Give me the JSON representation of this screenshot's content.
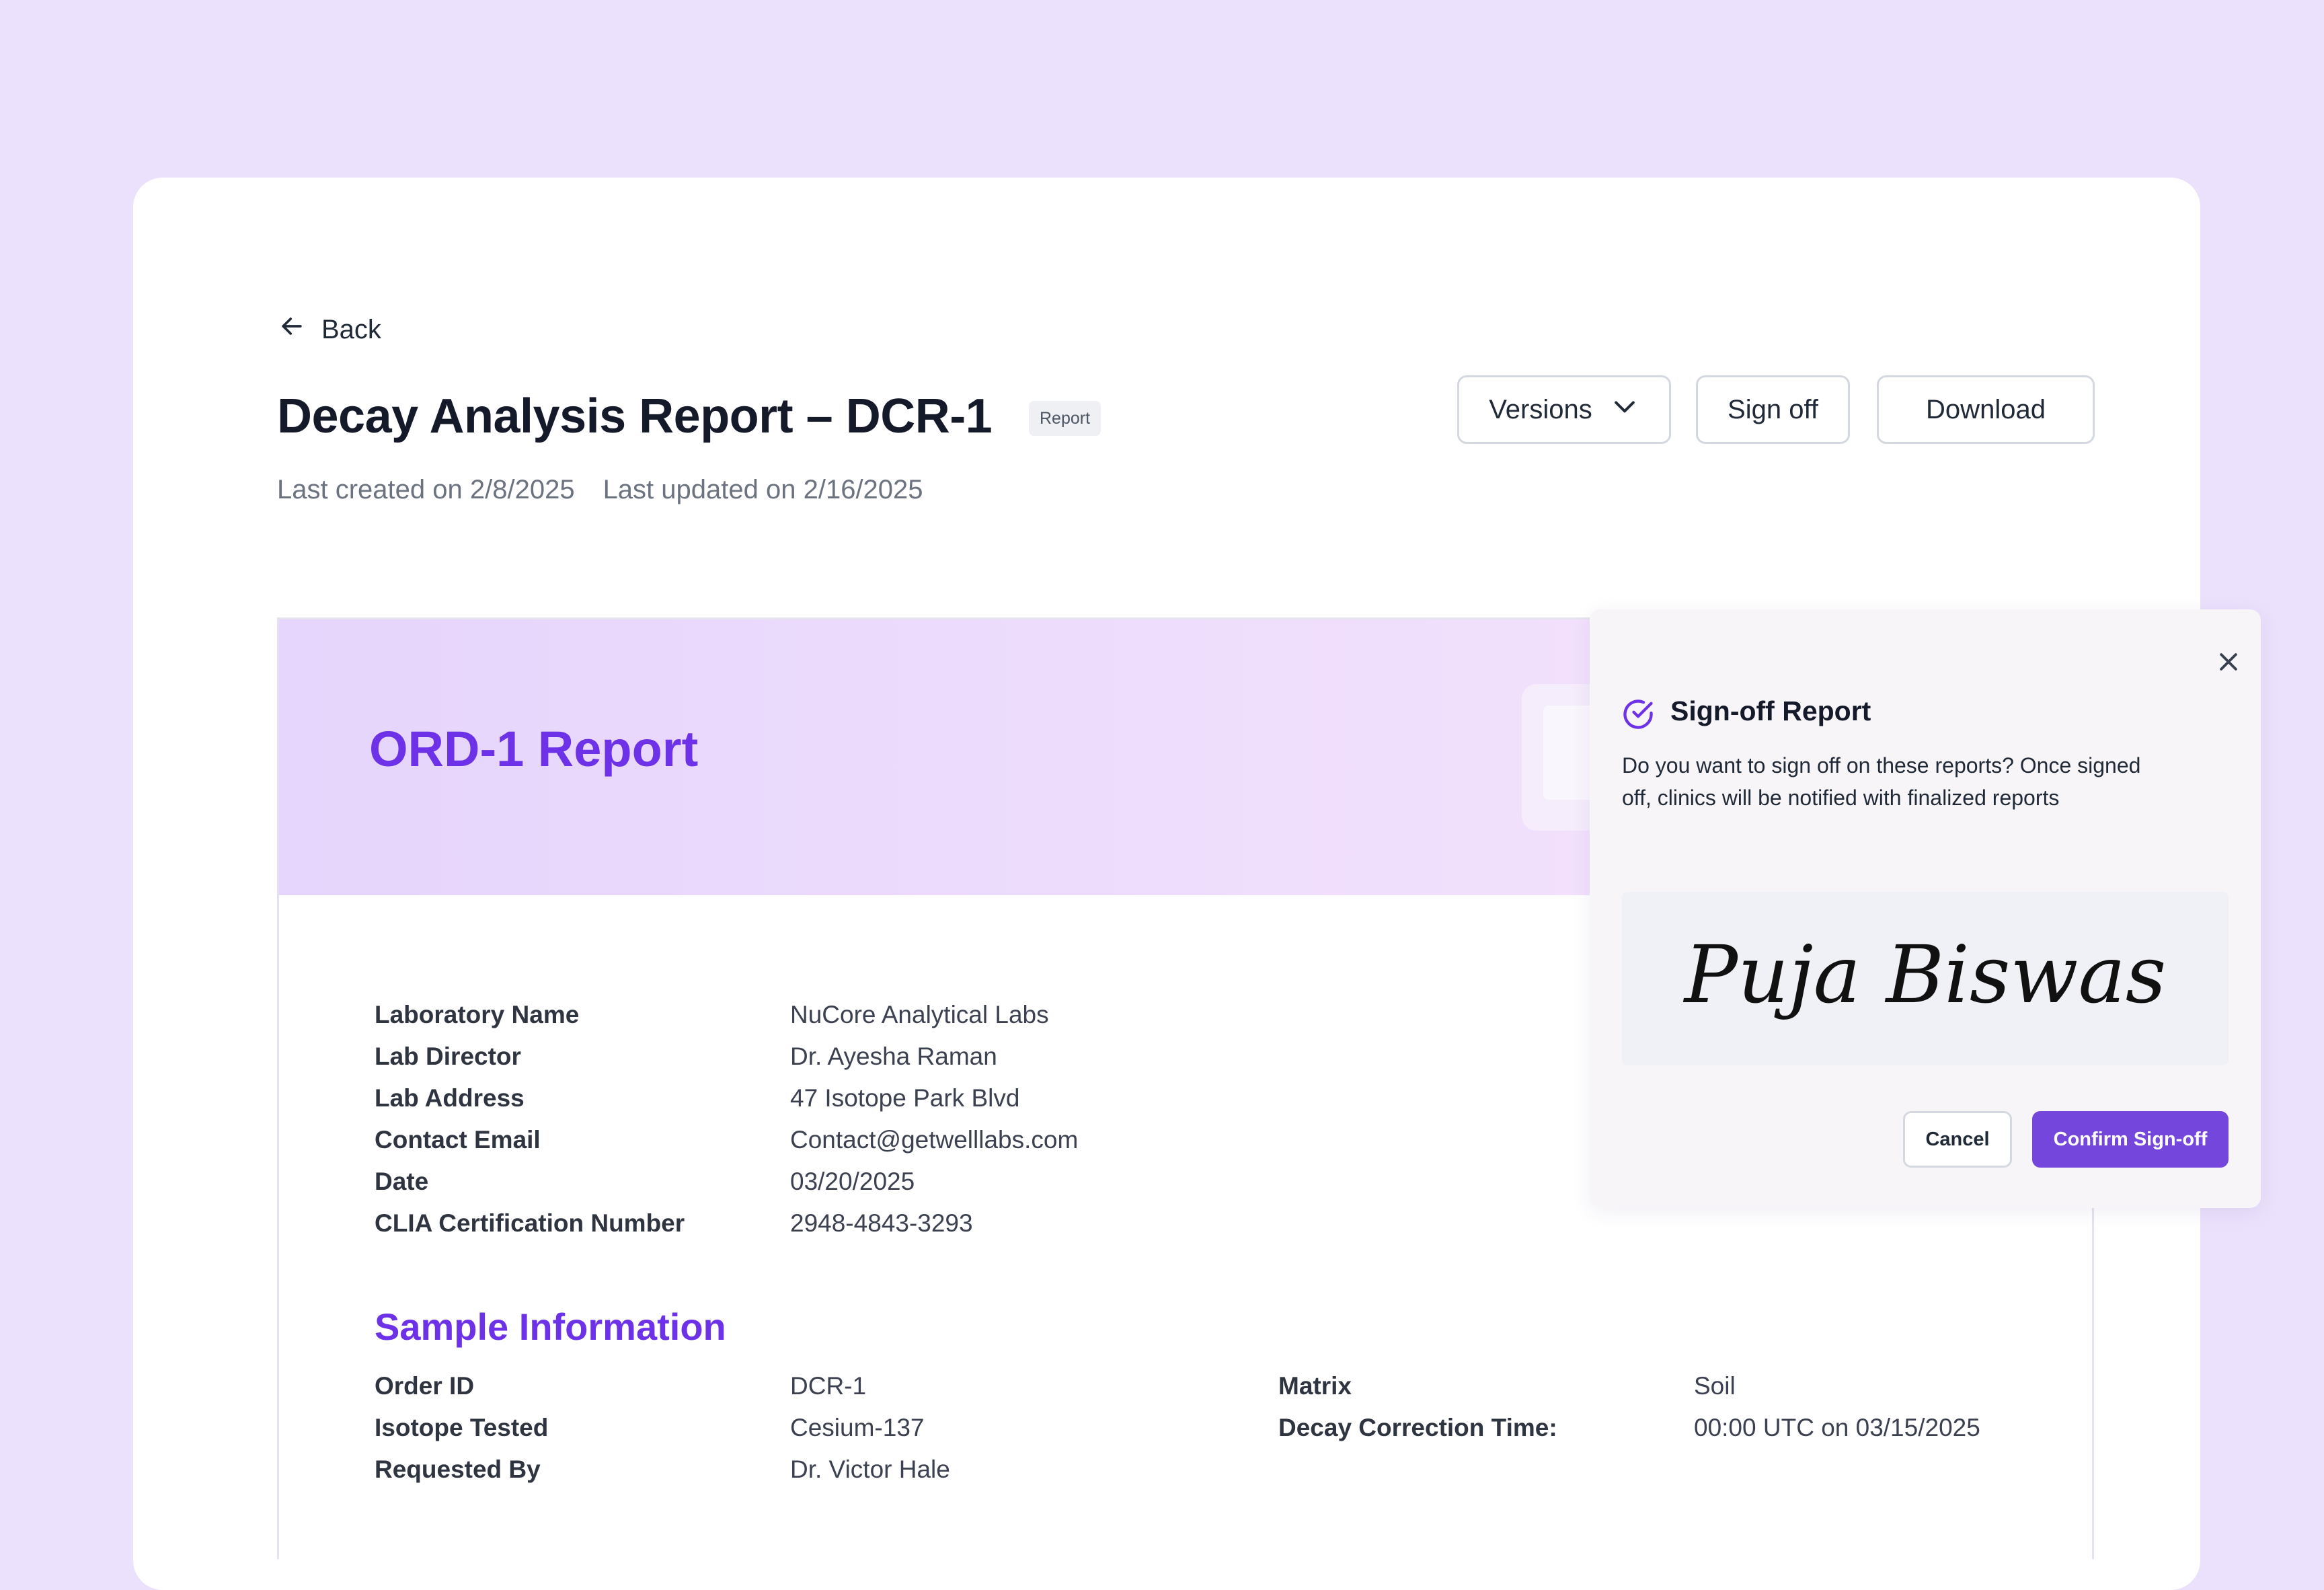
{
  "header": {
    "back_label": "Back",
    "title": "Decay Analysis Report – DCR-1",
    "tag": "Report",
    "created": "Last created on 2/8/2025",
    "updated": "Last updated on 2/16/2025"
  },
  "actions": {
    "versions": "Versions",
    "sign_off": "Sign off",
    "download": "Download"
  },
  "report": {
    "banner_title": "ORD-1 Report",
    "lab_info": [
      {
        "label": "Laboratory Name",
        "value": "NuCore Analytical Labs"
      },
      {
        "label": "Lab Director",
        "value": "Dr. Ayesha Raman"
      },
      {
        "label": "Lab Address",
        "value": "47 Isotope Park Blvd"
      },
      {
        "label": "Contact Email",
        "value": "Contact@getwelllabs.com"
      },
      {
        "label": "Date",
        "value": "03/20/2025"
      },
      {
        "label": "CLIA Certification Number",
        "value": "2948-4843-3293"
      }
    ],
    "sample_section_title": "Sample Information",
    "sample_left": [
      {
        "label": "Order ID",
        "value": "DCR-1"
      },
      {
        "label": "Isotope Tested",
        "value": "Cesium-137"
      },
      {
        "label": "Requested By",
        "value": "Dr. Victor Hale"
      }
    ],
    "sample_right": [
      {
        "label": "Matrix",
        "value": "Soil"
      },
      {
        "label": "Decay Correction Time:",
        "value": "00:00 UTC on 03/15/2025"
      }
    ]
  },
  "signoff_dialog": {
    "title": "Sign-off Report",
    "description": "Do you want to sign off on these reports? Once signed off, clinics will be notified with finalized reports",
    "signature": "Puja Biswas",
    "cancel": "Cancel",
    "confirm": "Confirm Sign-off"
  },
  "colors": {
    "background": "#ebe1fc",
    "accent": "#6d31e8",
    "confirm_button": "#7446db"
  },
  "icons": {
    "back": "arrow-left-icon",
    "versions": "chevron-down-icon",
    "close": "close-icon",
    "dialog": "check-circle-icon"
  }
}
